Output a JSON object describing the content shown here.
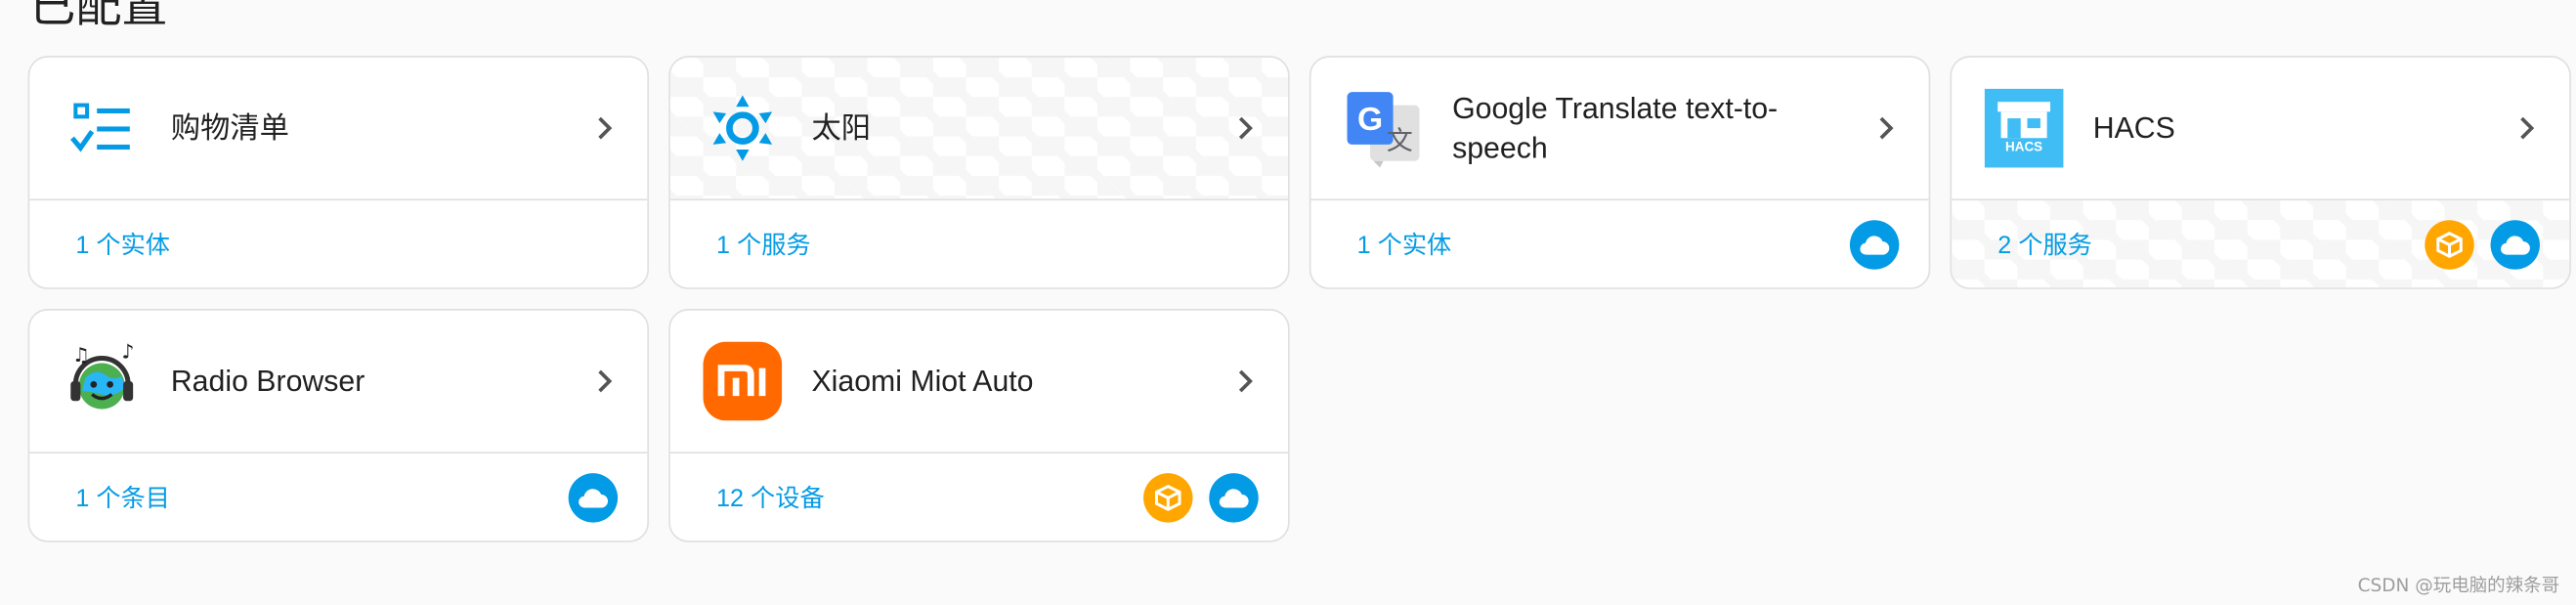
{
  "section": {
    "title": "已配置"
  },
  "colors": {
    "accent": "#039be5",
    "cloud_badge": "#039be5",
    "custom_badge": "#ffa600",
    "xiaomi": "#ff6900"
  },
  "cards": [
    {
      "name": "购物清单",
      "link": "1 个实体",
      "icon": "shopping-list-icon",
      "badges": []
    },
    {
      "name": "太阳",
      "link": "1 个服务",
      "icon": "sun-icon",
      "badges": []
    },
    {
      "name_line1": "Google Translate text-to-",
      "name_line2": "speech",
      "link": "1 个实体",
      "icon": "google-translate-icon",
      "badges": [
        "cloud-icon"
      ]
    },
    {
      "name": "HACS",
      "link": "2 个服务",
      "icon": "hacs-icon",
      "logo_text": "HACS",
      "badges": [
        "custom-integration-icon",
        "cloud-icon"
      ]
    },
    {
      "name": "Radio Browser",
      "link": "1 个条目",
      "icon": "radio-browser-icon",
      "badges": [
        "cloud-icon"
      ]
    },
    {
      "name": "Xiaomi Miot Auto",
      "link": "12 个设备",
      "icon": "xiaomi-icon",
      "logo_text": "mi",
      "badges": [
        "custom-integration-icon",
        "cloud-icon"
      ]
    }
  ],
  "watermark": "CSDN @玩电脑的辣条哥"
}
